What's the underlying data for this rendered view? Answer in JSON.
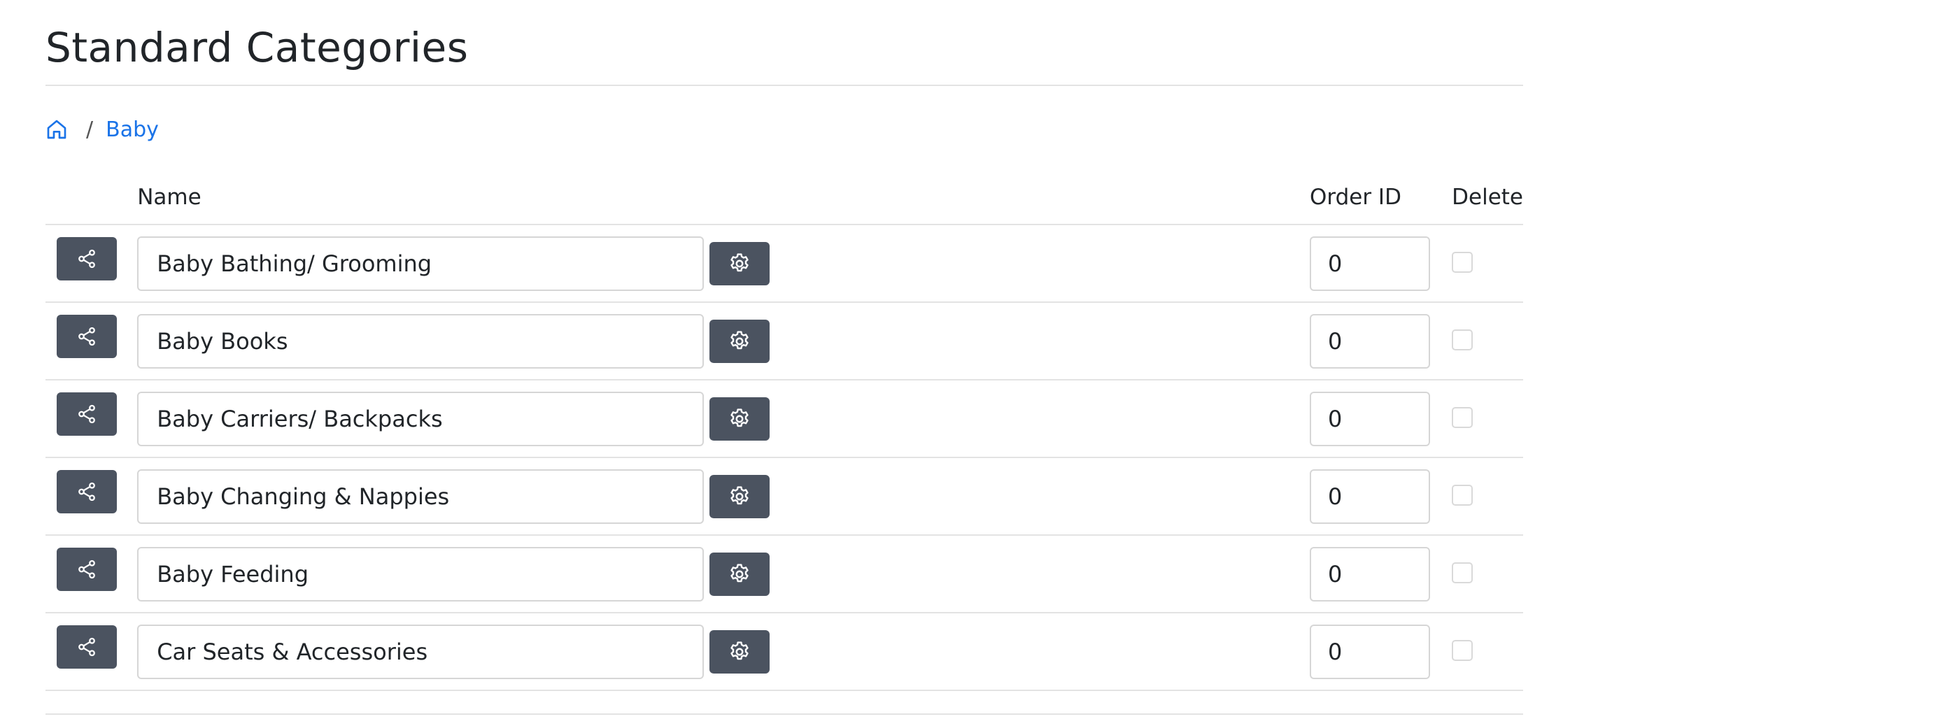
{
  "page": {
    "title": "Standard Categories"
  },
  "breadcrumb": {
    "home_icon": "home-icon",
    "separator": "/",
    "current": "Baby"
  },
  "table": {
    "headers": {
      "share": "",
      "name": "Name",
      "order_id": "Order ID",
      "delete": "Delete"
    },
    "rows": [
      {
        "name": "Baby Bathing/ Grooming",
        "order_id": "0",
        "delete": false
      },
      {
        "name": "Baby Books",
        "order_id": "0",
        "delete": false
      },
      {
        "name": "Baby Carriers/ Backpacks",
        "order_id": "0",
        "delete": false
      },
      {
        "name": "Baby Changing & Nappies",
        "order_id": "0",
        "delete": false
      },
      {
        "name": "Baby Feeding",
        "order_id": "0",
        "delete": false
      },
      {
        "name": "Car Seats & Accessories",
        "order_id": "0",
        "delete": false
      }
    ]
  },
  "icons": {
    "share": "share-icon",
    "settings": "gear-icon"
  },
  "colors": {
    "button_bg": "#4b5360",
    "link": "#1a73e8",
    "divider": "#e3e3e3"
  }
}
